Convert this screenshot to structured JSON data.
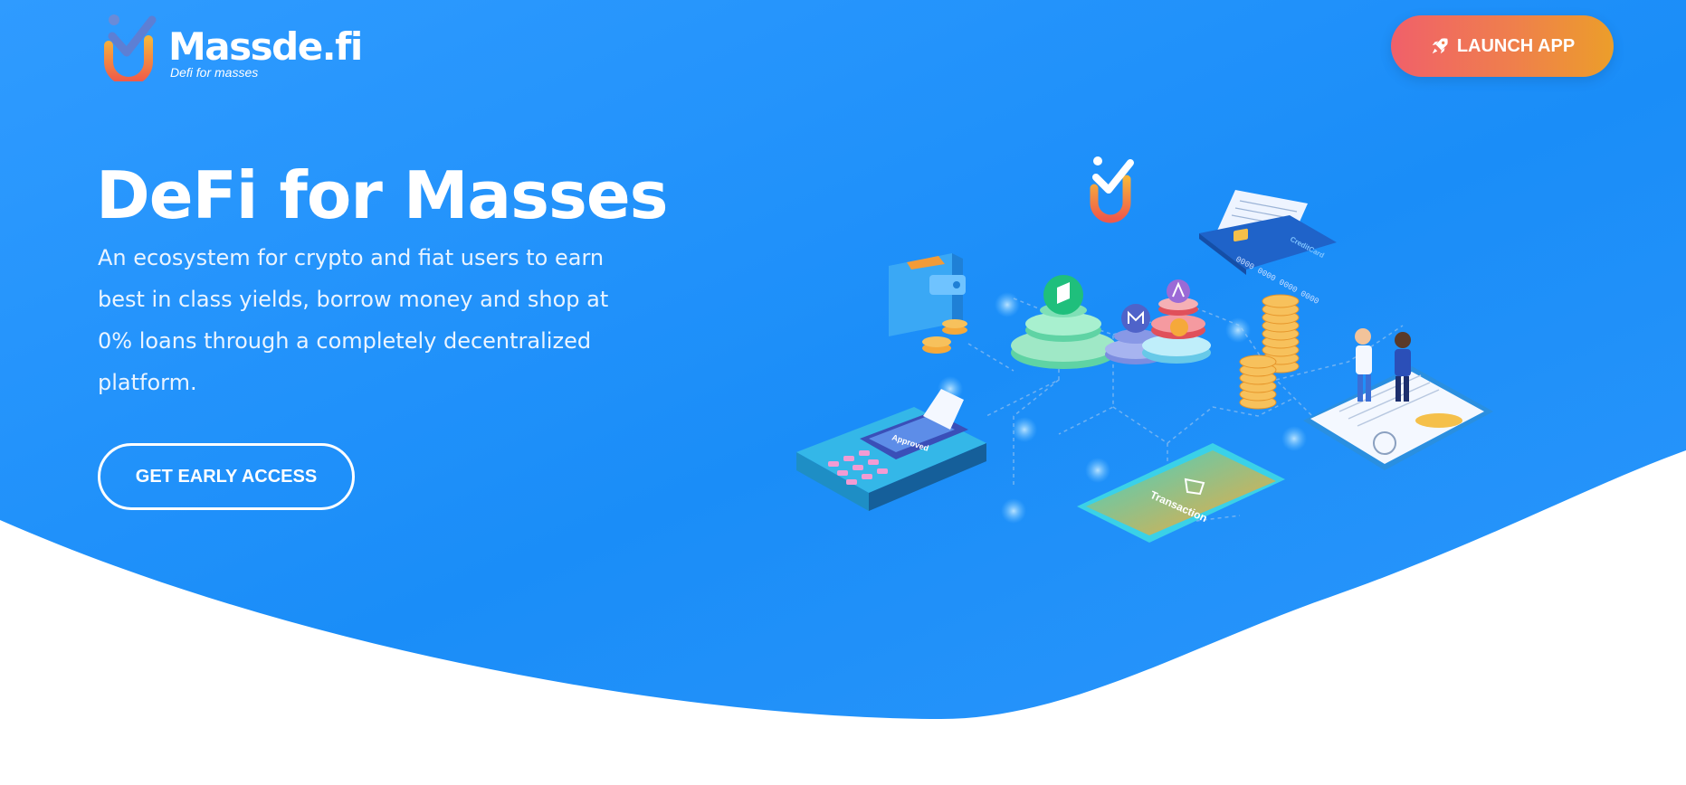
{
  "header": {
    "logo": {
      "name": "Massde.fi",
      "tagline": "Defi for masses"
    },
    "launch_button": {
      "label": "LAUNCH APP",
      "icon": "rocket-icon"
    }
  },
  "hero": {
    "title": "DeFi for Masses",
    "description": "An ecosystem for crypto and fiat users to earn best in class yields, borrow money and shop at 0% loans through a completely decentralized platform.",
    "cta": "GET EARLY ACCESS"
  },
  "illustration": {
    "pos_screen_text": "Approved",
    "phone_screen_text": "Transaction",
    "card_number": "0000 0000 0000 0000",
    "card_brand": "CreditCard"
  },
  "colors": {
    "hero_gradient_start": "#2f9bff",
    "hero_gradient_end": "#0f86f5",
    "launch_gradient_start": "#f0606a",
    "launch_gradient_end": "#ec9e2a",
    "text": "#ffffff"
  }
}
